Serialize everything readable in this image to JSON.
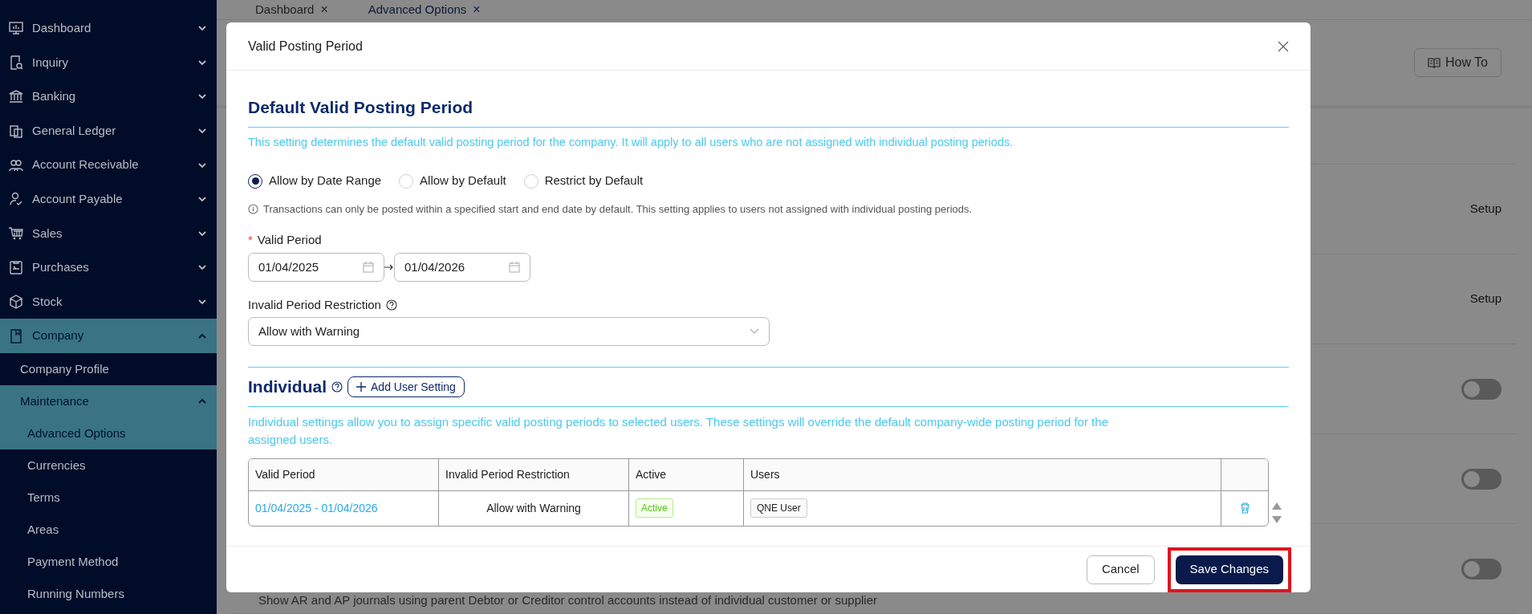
{
  "sidebar": {
    "items": [
      {
        "label": "Dashboard",
        "expanded": false,
        "selected": false
      },
      {
        "label": "Inquiry",
        "expanded": false,
        "selected": false
      },
      {
        "label": "Banking",
        "expanded": false,
        "selected": false
      },
      {
        "label": "General Ledger",
        "expanded": false,
        "selected": false
      },
      {
        "label": "Account Receivable",
        "expanded": false,
        "selected": false
      },
      {
        "label": "Account Payable",
        "expanded": false,
        "selected": false
      },
      {
        "label": "Sales",
        "expanded": false,
        "selected": false
      },
      {
        "label": "Purchases",
        "expanded": false,
        "selected": false
      },
      {
        "label": "Stock",
        "expanded": false,
        "selected": false
      },
      {
        "label": "Company",
        "expanded": true,
        "selected": true,
        "children": [
          {
            "label": "Company Profile",
            "selected": false
          },
          {
            "label": "Maintenance",
            "expanded": true,
            "selected": true,
            "children": [
              {
                "label": "Advanced Options",
                "selected": true
              },
              {
                "label": "Currencies",
                "selected": false
              },
              {
                "label": "Terms",
                "selected": false
              },
              {
                "label": "Areas",
                "selected": false
              },
              {
                "label": "Payment Method",
                "selected": false
              },
              {
                "label": "Running Numbers",
                "selected": false
              }
            ]
          }
        ]
      }
    ]
  },
  "tabs": [
    {
      "label": "Dashboard",
      "close": "×",
      "selected": false
    },
    {
      "label": "Advanced Options",
      "close": "×",
      "selected": true
    }
  ],
  "page": {
    "how_to_button": "How To",
    "rows": [
      {
        "kind": "setup",
        "label": "Setup"
      },
      {
        "kind": "setup",
        "label": "Setup"
      },
      {
        "kind": "toggle",
        "on": false
      },
      {
        "kind": "toggle",
        "on": false
      },
      {
        "kind": "toggle",
        "on": false,
        "description": "Show AR and AP journals using parent Debtor or Creditor control accounts instead of individual customer or supplier"
      }
    ]
  },
  "dialog": {
    "title": "Valid Posting Period",
    "default_section": {
      "heading": "Default Valid Posting Period",
      "description": "This setting determines the default valid posting period for the company. It will apply to all users who are not assigned with individual posting periods.",
      "options": [
        {
          "label": "Allow by Date Range",
          "selected": true
        },
        {
          "label": "Allow by Default",
          "selected": false
        },
        {
          "label": "Restrict by Default",
          "selected": false
        }
      ],
      "info": "Transactions can only be posted within a specified start and end date by default. This setting applies to users not assigned with individual posting periods.",
      "valid_period": {
        "label": "Valid Period",
        "required_mark": "*",
        "start": "01/04/2025",
        "end": "01/04/2026"
      },
      "restriction": {
        "label": "Invalid Period Restriction",
        "value": "Allow with Warning"
      }
    },
    "individual_section": {
      "heading": "Individual",
      "add_button": "Add User Setting",
      "description": "Individual settings allow you to assign specific valid posting periods to selected users. These settings will override the default company-wide posting period for the assigned users.",
      "table": {
        "columns": [
          "Valid Period",
          "Invalid Period Restriction",
          "Active",
          "Users"
        ],
        "rows": [
          {
            "valid_period": "01/04/2025 - 01/04/2026",
            "restriction_label": "Allow with Warning",
            "active": "Active",
            "users": [
              "QNE User"
            ]
          }
        ]
      }
    },
    "buttons": [
      {
        "label": "Cancel",
        "kind": "secondary",
        "highlighted": false
      },
      {
        "label": "Save Changes",
        "kind": "primary",
        "highlighted": true
      }
    ]
  }
}
